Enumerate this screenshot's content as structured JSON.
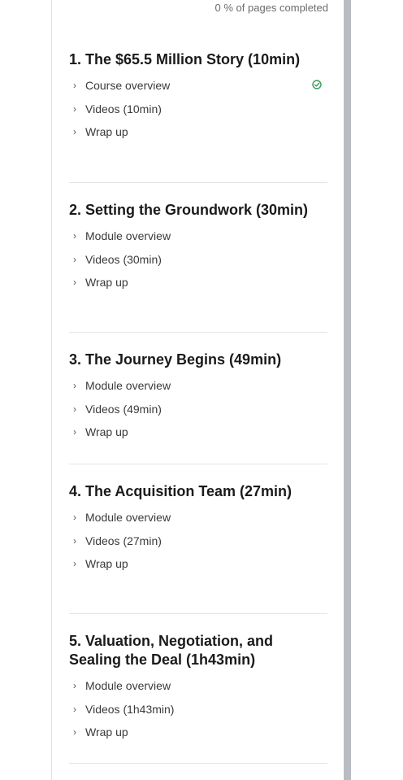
{
  "progress_label": "0 % of pages completed",
  "modules": [
    {
      "title": "1. The $65.5 Million Story (10min)",
      "items": [
        {
          "label": "Course overview",
          "completed": true
        },
        {
          "label": "Videos (10min)",
          "completed": false
        },
        {
          "label": "Wrap up",
          "completed": false
        }
      ]
    },
    {
      "title": "2. Setting the Groundwork (30min)",
      "items": [
        {
          "label": "Module overview",
          "completed": false
        },
        {
          "label": "Videos (30min)",
          "completed": false
        },
        {
          "label": "Wrap up",
          "completed": false
        }
      ]
    },
    {
      "title": "3. The Journey Begins (49min)",
      "items": [
        {
          "label": "Module overview",
          "completed": false
        },
        {
          "label": "Videos (49min)",
          "completed": false
        },
        {
          "label": "Wrap up",
          "completed": false
        }
      ]
    },
    {
      "title": "4. The Acquisition Team (27min)",
      "items": [
        {
          "label": "Module overview",
          "completed": false
        },
        {
          "label": "Videos (27min)",
          "completed": false
        },
        {
          "label": "Wrap up",
          "completed": false
        }
      ]
    },
    {
      "title": "5. Valuation, Negotiation, and Sealing the Deal (1h43min)",
      "items": [
        {
          "label": "Module overview",
          "completed": false
        },
        {
          "label": "Videos (1h43min)",
          "completed": false
        },
        {
          "label": "Wrap up",
          "completed": false
        }
      ]
    }
  ],
  "colors": {
    "check": "#3a9a5b",
    "scrollbar": "#b9bcc2"
  }
}
